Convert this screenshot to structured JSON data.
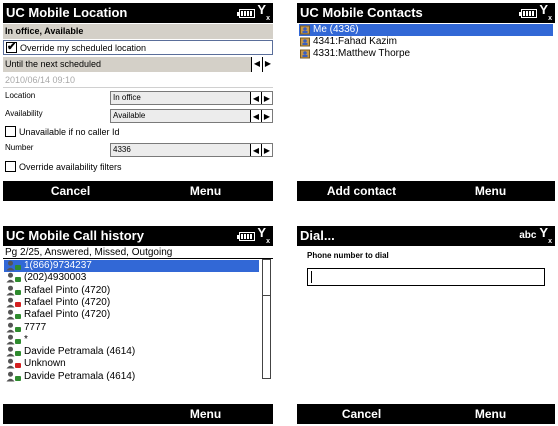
{
  "status_icons": {
    "battery": "battery-icon",
    "signal": "signal-icon",
    "signal_glyph": "Y",
    "signal_sub": "x",
    "input_mode": "abc"
  },
  "location": {
    "title": "UC Mobile Location",
    "status_line": "In office, Available",
    "override_label": "Override my scheduled location",
    "override_checked": true,
    "until_value": "Until the next scheduled",
    "date_value": "2010/06/14 09:10",
    "location_label": "Location",
    "location_value": "In office",
    "availability_label": "Availability",
    "availability_value": "Available",
    "unavailable_label": "Unavailable if no caller Id",
    "number_label": "Number",
    "number_value": "4336",
    "override_filters_label": "Override availability filters",
    "left_soft": "Cancel",
    "right_soft": "Menu",
    "arrow_left": "◀",
    "arrow_right": "▶"
  },
  "contacts": {
    "title": "UC Mobile Contacts",
    "items": [
      {
        "name": "Me (4336)",
        "selected": true
      },
      {
        "name": "4341:Fahad Kazim",
        "selected": false
      },
      {
        "name": "4331:Matthew Thorpe",
        "selected": false
      }
    ],
    "left_soft": "Add contact",
    "right_soft": "Menu"
  },
  "calls": {
    "title": "UC Mobile Call history",
    "subtitle": "Pg 2/25, Answered, Missed, Outgoing",
    "items": [
      {
        "name": "1(866)9734237",
        "type": "answered",
        "selected": true
      },
      {
        "name": "(202)4930003",
        "type": "answered"
      },
      {
        "name": "Rafael Pinto (4720)",
        "type": "answered"
      },
      {
        "name": "Rafael Pinto (4720)",
        "type": "missed"
      },
      {
        "name": "Rafael Pinto (4720)",
        "type": "answered"
      },
      {
        "name": "7777",
        "type": "answered"
      },
      {
        "name": "*",
        "type": "answered"
      },
      {
        "name": "Davide Petramala (4614)",
        "type": "answered"
      },
      {
        "name": "Unknown",
        "type": "missed"
      },
      {
        "name": "Davide Petramala (4614)",
        "type": "answered"
      }
    ],
    "right_soft": "Menu",
    "colors": {
      "answered": "#2e8b2e",
      "missed": "#d42020"
    }
  },
  "dial": {
    "title": "Dial...",
    "prompt": "Phone number to dial",
    "input_value": "",
    "left_soft": "Cancel",
    "right_soft": "Menu"
  },
  "colors": {
    "selection": "#3268d6",
    "bar": "#000000",
    "field_gray": "#d4d0c8"
  }
}
